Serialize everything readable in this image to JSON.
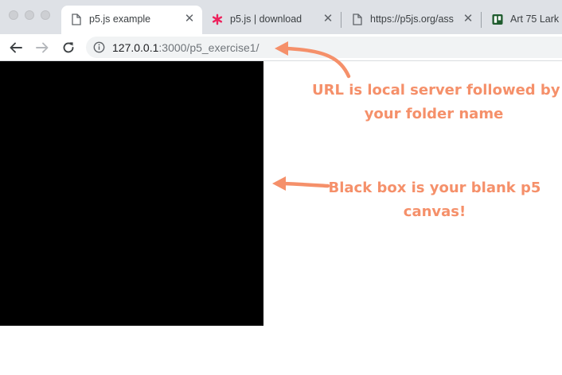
{
  "tabs": [
    {
      "title": "p5.js example",
      "icon": "document-icon",
      "active": true
    },
    {
      "title": "p5.js | download",
      "icon": "p5-asterisk-icon",
      "active": false
    },
    {
      "title": "https://p5js.org/ass",
      "icon": "document-icon",
      "active": false
    },
    {
      "title": "Art 75 Lark",
      "icon": "trello-icon",
      "active": false
    }
  ],
  "toolbar": {
    "url_host": "127.0.0.1",
    "url_rest": ":3000/p5_exercise1/"
  },
  "annotations": {
    "url_note_line1": "URL is local server followed by",
    "url_note_line2": "your folder name",
    "canvas_note_line1": "Black box is your blank p5",
    "canvas_note_line2": "canvas!"
  },
  "colors": {
    "annotation": "#f5906a",
    "p5_brand": "#ed225d",
    "canvas": "#000000"
  }
}
